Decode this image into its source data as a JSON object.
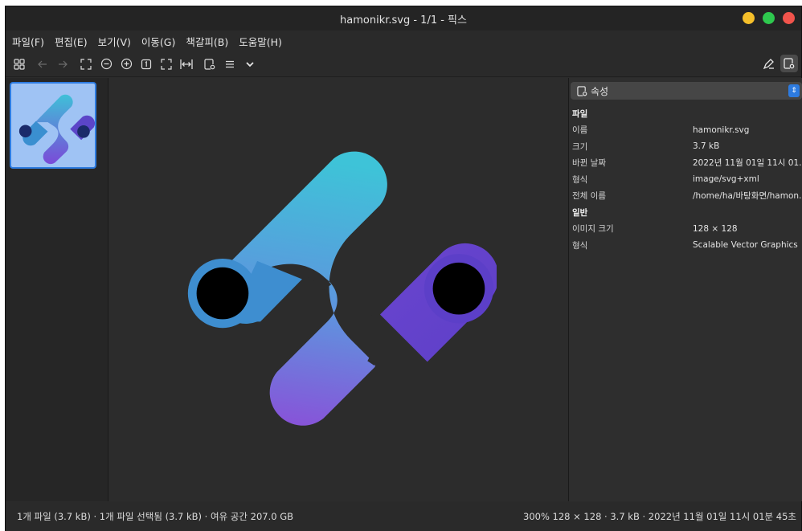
{
  "window": {
    "title": "hamonikr.svg - 1/1 - 픽스",
    "controls": [
      {
        "name": "minimize",
        "color": "#f5bf2a"
      },
      {
        "name": "maximize",
        "color": "#2ec84e"
      },
      {
        "name": "close",
        "color": "#f1544c"
      }
    ]
  },
  "menu": [
    "파일(F)",
    "편집(E)",
    "보기(V)",
    "이동(G)",
    "책갈피(B)",
    "도움말(H)"
  ],
  "toolbar": {
    "icons": [
      "grid-icon",
      "back-arrow-icon",
      "forward-arrow-icon",
      "fit-icon",
      "zoom-out-icon",
      "zoom-in-icon",
      "zoom-original-icon",
      "fullscreen-icon",
      "fit-width-icon",
      "properties-icon",
      "menu-icon",
      "chevron-down-icon"
    ],
    "right_icons": [
      "edit-icon",
      "properties-panel-icon"
    ]
  },
  "properties": {
    "selector_label": "속성",
    "sections": [
      {
        "title": "파일",
        "rows": [
          {
            "key": "이름",
            "value": "hamonikr.svg"
          },
          {
            "key": "크기",
            "value": "3.7 kB"
          },
          {
            "key": "바뀐 날짜",
            "value": "2022년 11월 01일 11시 01…"
          },
          {
            "key": "형식",
            "value": "image/svg+xml"
          },
          {
            "key": "전체 이름",
            "value": "/home/ha/바탕화면/hamon…"
          }
        ]
      },
      {
        "title": "일반",
        "rows": [
          {
            "key": "이미지 크기",
            "value": "128 × 128"
          },
          {
            "key": "형식",
            "value": "Scalable Vector Graphics"
          }
        ]
      }
    ]
  },
  "status": {
    "left": "1개 파일 (3.7 kB) · 1개 파일 선택됨 (3.7 kB) · 여유 공간 207.0 GB",
    "right": "300% 128 × 128 · 3.7 kB · 2022년 11월 01일 11시 01분 45초"
  },
  "colors": {
    "accent": "#2d7be0",
    "logo_teal": "#3fc0d8",
    "logo_purple": "#7a4ad8"
  }
}
